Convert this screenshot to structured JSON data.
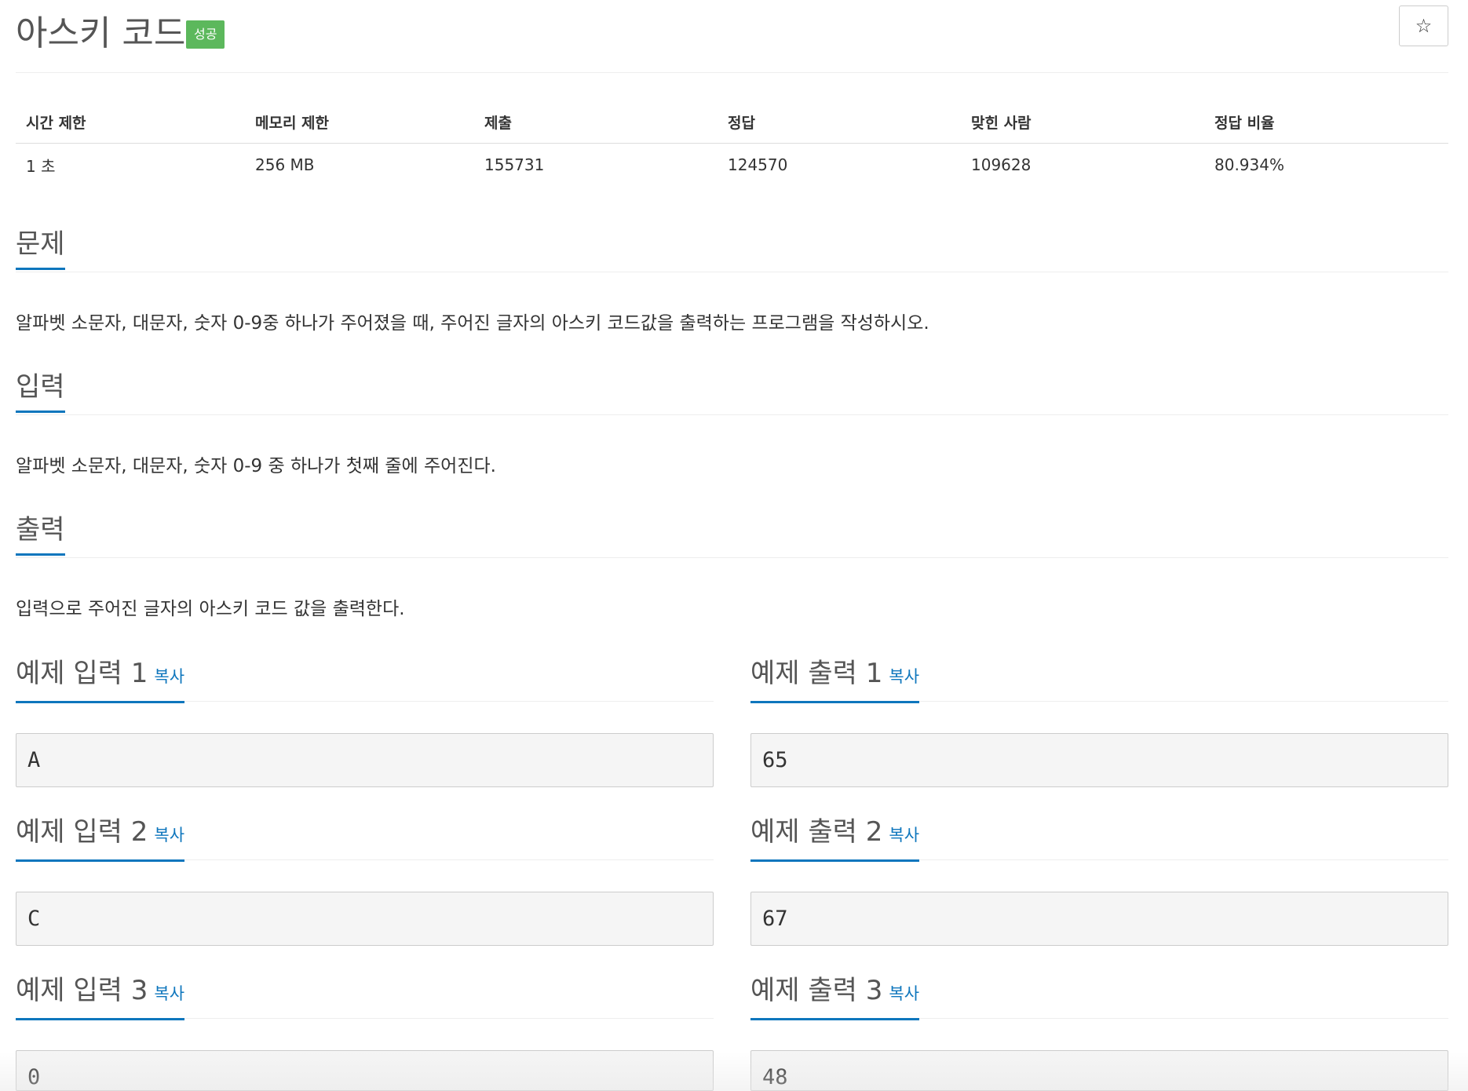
{
  "problem": {
    "title": "아스키 코드",
    "badge": "성공",
    "star": "☆"
  },
  "info": {
    "headers": [
      "시간 제한",
      "메모리 제한",
      "제출",
      "정답",
      "맞힌 사람",
      "정답 비율"
    ],
    "values": [
      "1 초",
      "256 MB",
      "155731",
      "124570",
      "109628",
      "80.934%"
    ]
  },
  "sections": {
    "description": {
      "heading": "문제",
      "text": "알파벳 소문자, 대문자, 숫자 0-9중 하나가 주어졌을 때, 주어진 글자의 아스키 코드값을 출력하는 프로그램을 작성하시오."
    },
    "input": {
      "heading": "입력",
      "text": "알파벳 소문자, 대문자, 숫자 0-9 중 하나가 첫째 줄에 주어진다."
    },
    "output": {
      "heading": "출력",
      "text": "입력으로 주어진 글자의 아스키 코드 값을 출력한다."
    }
  },
  "samples": [
    {
      "in_label": "예제 입력 1",
      "out_label": "예제 출력 1",
      "copy": "복사",
      "input": "A",
      "output": "65"
    },
    {
      "in_label": "예제 입력 2",
      "out_label": "예제 출력 2",
      "copy": "복사",
      "input": "C",
      "output": "67"
    },
    {
      "in_label": "예제 입력 3",
      "out_label": "예제 출력 3",
      "copy": "복사",
      "input": "0",
      "output": "48"
    }
  ],
  "colors": {
    "success_badge": "#5cb85c",
    "accent": "#0e76bd"
  }
}
